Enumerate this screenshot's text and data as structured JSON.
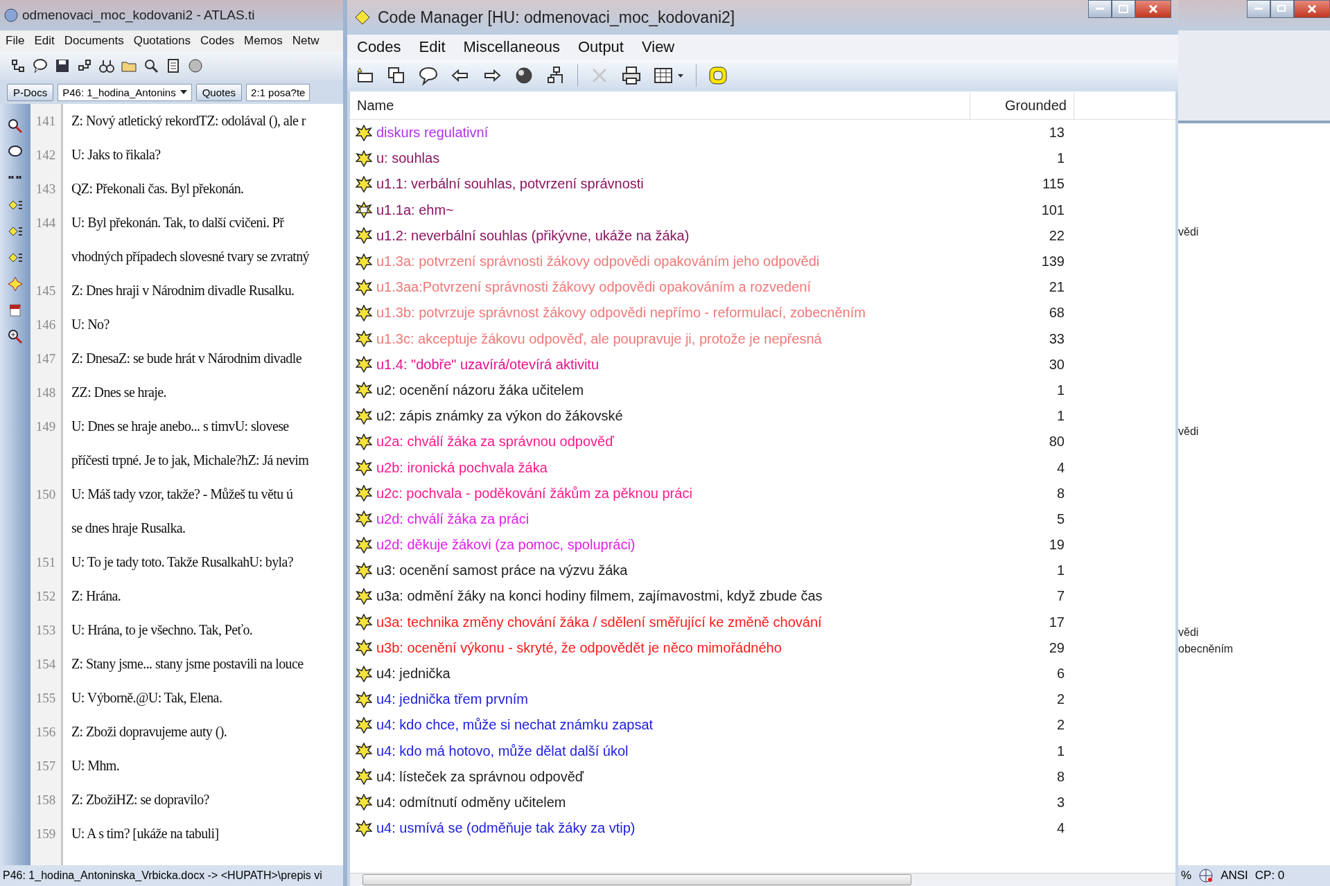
{
  "main_window": {
    "title": "odmenovaci_moc_kodovani2 - ATLAS.ti",
    "menu": [
      "File",
      "Edit",
      "Documents",
      "Quotations",
      "Codes",
      "Memos",
      "Netw"
    ],
    "doc_bar": {
      "pdocs_button": "P-Docs",
      "document": "P46: 1_hodina_Antonins",
      "quotes_button": "Quotes",
      "quote": "2:1 posa?te"
    },
    "lines": [
      {
        "number": "141",
        "text": "Z: Nový atletický rekordTZ: odolával (), ale r"
      },
      {
        "number": "142",
        "text": "U: Jaks to řikala?"
      },
      {
        "number": "143",
        "text": "QZ: Překonali čas. Byl překonán."
      },
      {
        "number": "144",
        "text": "U: Byl překonán. Tak, to další cvičeni. Př"
      },
      {
        "text": "vhodných případech slovesné tvary se zvratný"
      },
      {
        "number": "145",
        "text": "Z: Dnes hraji v Národnim divadle Rusalku."
      },
      {
        "number": "146",
        "text": "U: No?"
      },
      {
        "number": "147",
        "text": "Z: DnesaZ: se bude hrát v Národnim divadle"
      },
      {
        "number": "148",
        "text": "ZZ: Dnes se hraje."
      },
      {
        "number": "149",
        "text": "U: Dnes se hraje anebo... s  timvU: slovese"
      },
      {
        "text": "příčesti trpné. Je to jak, Michale?hZ: Já nevim"
      },
      {
        "number": "150",
        "text": "U: Máš tady vzor, takže? - Můžeš tu větu ú"
      },
      {
        "text": "se dnes hraje Rusalka."
      },
      {
        "number": "151",
        "text": "U: To je tady toto. Takže RusalkahU: byla?"
      },
      {
        "number": "152",
        "text": "Z: Hrána."
      },
      {
        "number": "153",
        "text": "U: Hrána, to je všechno. Tak, Peťo."
      },
      {
        "number": "154",
        "text": "Z: Stany jsme... stany jsme postavili na louce"
      },
      {
        "number": "155",
        "text": "U: Výborně.@U: Tak, Elena."
      },
      {
        "number": "156",
        "text": "Z: Zboži dopravujeme auty ()."
      },
      {
        "number": "157",
        "text": "U: Mhm."
      },
      {
        "number": "158",
        "text": "Z: ZbožiHZ: se dopravilo?"
      },
      {
        "number": "159",
        "text": "U: A s tim? [ukáže na tabuli]"
      }
    ],
    "status": "P46: 1_hodina_Antoninska_Vrbicka.docx -> <HUPATH>\\prepis vi"
  },
  "code_manager": {
    "title": "Code Manager [HU: odmenovaci_moc_kodovani2]",
    "menu": [
      "Codes",
      "Edit",
      "Miscellaneous",
      "Output",
      "View"
    ],
    "toolbar": [
      {
        "kind": "new",
        "disabled": false
      },
      {
        "kind": "copy",
        "disabled": false
      },
      {
        "kind": "comment",
        "disabled": false
      },
      {
        "kind": "back",
        "disabled": false
      },
      {
        "kind": "forward",
        "disabled": false
      },
      {
        "kind": "sphere",
        "disabled": false
      },
      {
        "kind": "tree",
        "disabled": false
      },
      {
        "kind": "delete",
        "disabled": true
      },
      {
        "kind": "print",
        "disabled": false
      },
      {
        "kind": "grid",
        "disabled": false
      },
      {
        "kind": "ring",
        "disabled": false
      }
    ],
    "columns": [
      "Name",
      "Grounded"
    ],
    "rows": [
      {
        "kind": "code",
        "name": "diskurs regulativní",
        "grounded": "13",
        "color": "#b030f0"
      },
      {
        "kind": "code",
        "name": "u: souhlas",
        "grounded": "1",
        "color": "#8b1560"
      },
      {
        "kind": "code",
        "name": "u1.1: verbální souhlas, potvrzení správnosti",
        "grounded": "115",
        "color": "#8b1560"
      },
      {
        "kind": "commented",
        "name": "u1.1a: ehm~",
        "grounded": "101",
        "color": "#8b1560"
      },
      {
        "kind": "code",
        "name": "u1.2: neverbální souhlas (přikývne, ukáže na žáka)",
        "grounded": "22",
        "color": "#8b1560"
      },
      {
        "kind": "code",
        "name": "u1.3a: potvrzení správnosti žákovy odpovědi opakováním jeho odpovědi",
        "grounded": "139",
        "color": "#f07878"
      },
      {
        "kind": "code",
        "name": "u1.3aa:Potvrzení správnosti žákovy odpovědi opakováním a rozvedení",
        "grounded": "21",
        "color": "#f07878"
      },
      {
        "kind": "code",
        "name": "u1.3b: potvrzuje správnost žákovy odpovědi nepřímo - reformulací, zobecněním",
        "grounded": "68",
        "color": "#f07878"
      },
      {
        "kind": "code",
        "name": "u1.3c: akceptuje žákovu odpověď, ale poupravuje ji, protože je nepřesná",
        "grounded": "33",
        "color": "#f07878"
      },
      {
        "kind": "code",
        "name": "u1.4: \"dobře\" uzavírá/otevírá aktivitu",
        "grounded": "30",
        "color": "#e8108c"
      },
      {
        "kind": "code",
        "name": "u2: ocenění názoru žáka učitelem",
        "grounded": "1",
        "color": "#202020"
      },
      {
        "kind": "code",
        "name": "u2: zápis známky za výkon do žákovské",
        "grounded": "1",
        "color": "#202020"
      },
      {
        "kind": "code",
        "name": "u2a: chválí žáka za správnou odpověď",
        "grounded": "80",
        "color": "#ff1a8c"
      },
      {
        "kind": "code",
        "name": "u2b: ironická pochvala žáka",
        "grounded": "4",
        "color": "#ff1a8c"
      },
      {
        "kind": "code",
        "name": "u2c: pochvala - poděkování žákům za pěknou práci",
        "grounded": "8",
        "color": "#ff1a8c"
      },
      {
        "kind": "code",
        "name": "u2d: chválí žáka za práci",
        "grounded": "5",
        "color": "#e020e8"
      },
      {
        "kind": "code",
        "name": "u2d: děkuje žákovi (za pomoc, spolupráci)",
        "grounded": "19",
        "color": "#e020e8"
      },
      {
        "kind": "code",
        "name": "u3: ocenění samost práce na výzvu žáka",
        "grounded": "1",
        "color": "#202020"
      },
      {
        "kind": "code",
        "name": "u3a: odmění žáky na konci hodiny filmem, zajímavostmi, když zbude čas",
        "grounded": "7",
        "color": "#202020"
      },
      {
        "kind": "code",
        "name": "u3a: technika změny chování žáka / sdělení směřující ke změně chování",
        "grounded": "17",
        "color": "#ff1a1a"
      },
      {
        "kind": "code",
        "name": "u3b: ocenění výkonu - skryté, že odpovědět je něco mimořádného",
        "grounded": "29",
        "color": "#ff1a1a"
      },
      {
        "kind": "code",
        "name": "u4: jednička",
        "grounded": "6",
        "color": "#202020"
      },
      {
        "kind": "code",
        "name": "u4: jednička třem prvním",
        "grounded": "2",
        "color": "#2020e0"
      },
      {
        "kind": "code",
        "name": "u4: kdo chce, může si nechat známku zapsat",
        "grounded": "2",
        "color": "#2020e0"
      },
      {
        "kind": "code",
        "name": "u4: kdo má hotovo, může dělat další úkol",
        "grounded": "1",
        "color": "#2020e0"
      },
      {
        "kind": "code",
        "name": "u4: lísteček za správnou odpověď",
        "grounded": "8",
        "color": "#202020"
      },
      {
        "kind": "code",
        "name": "u4: odmítnutí odměny učitelem",
        "grounded": "3",
        "color": "#202020"
      },
      {
        "kind": "code",
        "name": "u4: usmívá se (odměňuje tak žáky za vtip)",
        "grounded": "4",
        "color": "#2020e0"
      }
    ]
  },
  "background_window": {
    "fragments": [
      "vědi",
      "vědi",
      "vědi",
      "obecněním"
    ],
    "status": {
      "zoom": "%",
      "encoding": "ANSI",
      "code_page": "CP: 0"
    }
  }
}
